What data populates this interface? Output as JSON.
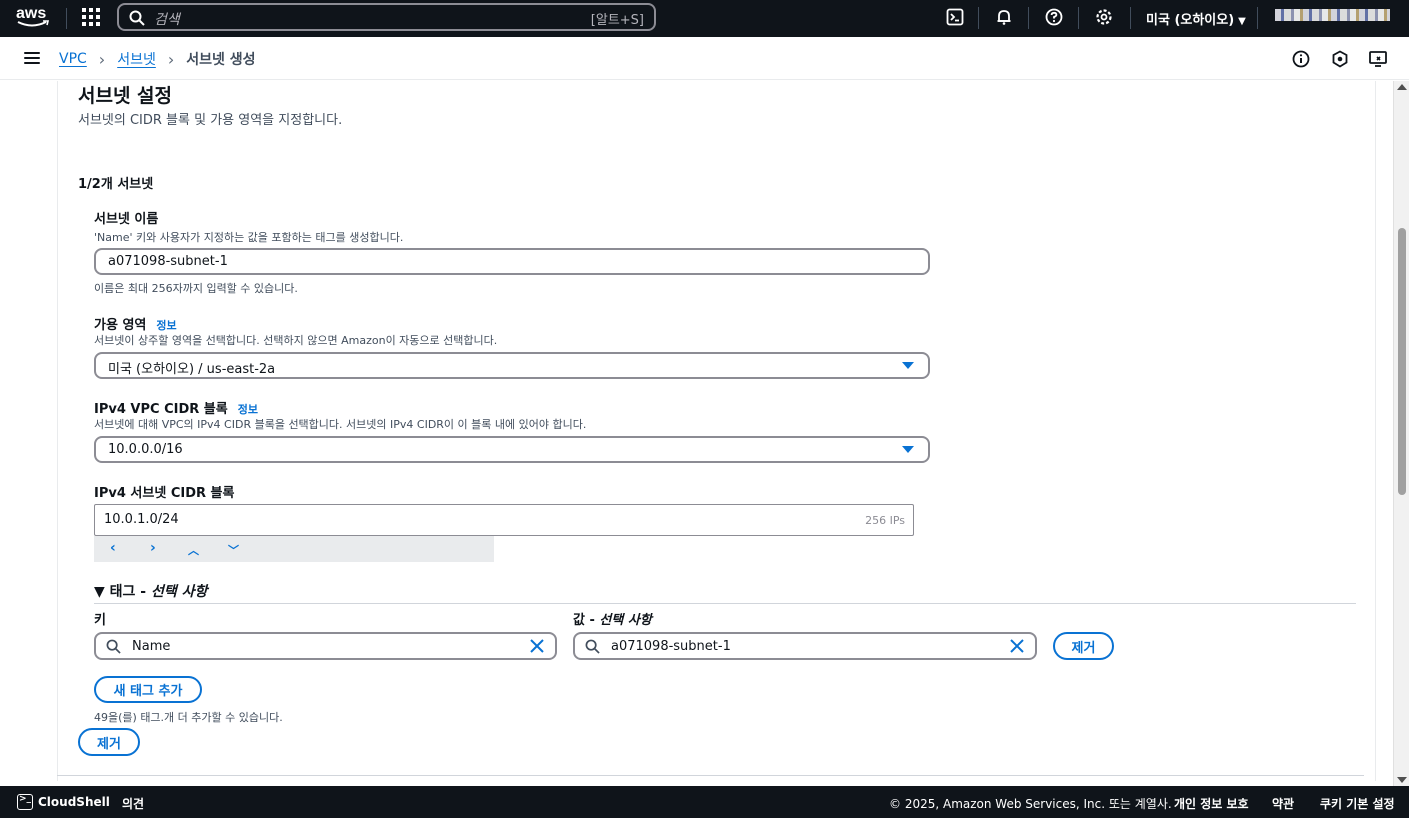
{
  "topnav": {
    "logo_text": "aws",
    "search_placeholder": "검색",
    "search_shortcut": "[알트+S]",
    "region": "미국 (오하이오)"
  },
  "breadcrumb": {
    "items": [
      "VPC",
      "서브넷"
    ],
    "current": "서브넷 생성"
  },
  "section": {
    "title": "서브넷 설정",
    "description": "서브넷의 CIDR 블록 및 가용 영역을 지정합니다.",
    "subnet_count": "1/2개 서브넷"
  },
  "subnet_name": {
    "label": "서브넷 이름",
    "hint": "'Name' 키와 사용자가 지정하는 값을 포함하는 태그를 생성합니다.",
    "value": "a071098-subnet-1",
    "constraint": "이름은 최대 256자까지 입력할 수 있습니다."
  },
  "az": {
    "label": "가용 영역",
    "info": "정보",
    "hint": "서브넷이 상주할 영역을 선택합니다. 선택하지 않으면 Amazon이 자동으로 선택합니다.",
    "value": "미국 (오하이오) / us-east-2a"
  },
  "vpc_cidr": {
    "label": "IPv4 VPC CIDR 블록",
    "info": "정보",
    "hint": "서브넷에 대해 VPC의 IPv4 CIDR 블록을 선택합니다. 서브넷의 IPv4 CIDR이 이 블록 내에 있어야 합니다.",
    "value": "10.0.0.0/16"
  },
  "subnet_cidr": {
    "label": "IPv4 서브넷 CIDR 블록",
    "value": "10.0.1.0/24",
    "ips": "256 IPs"
  },
  "tags": {
    "heading": "▼ 태그 - ",
    "heading_optional": "선택 사항",
    "key_label": "키",
    "value_label": "값 - ",
    "value_label_optional": "선택 사항",
    "key_value": "Name",
    "value_value": "a071098-subnet-1",
    "remove_label": "제거",
    "add_label": "새 태그 추가",
    "remaining": "49을(를) 태그.개 더 추가할 수 있습니다."
  },
  "remove_subnet_label": "제거",
  "footer": {
    "cloudshell": "CloudShell",
    "feedback": "의견",
    "copyright": "© 2025, Amazon Web Services, Inc. 또는 계열사.",
    "privacy": "개인 정보 보호",
    "terms": "약관",
    "cookies": "쿠키 기본 설정"
  },
  "colors": {
    "nav_bg": "#0f141a",
    "link": "#0972d3",
    "border": "#8c8c94"
  }
}
